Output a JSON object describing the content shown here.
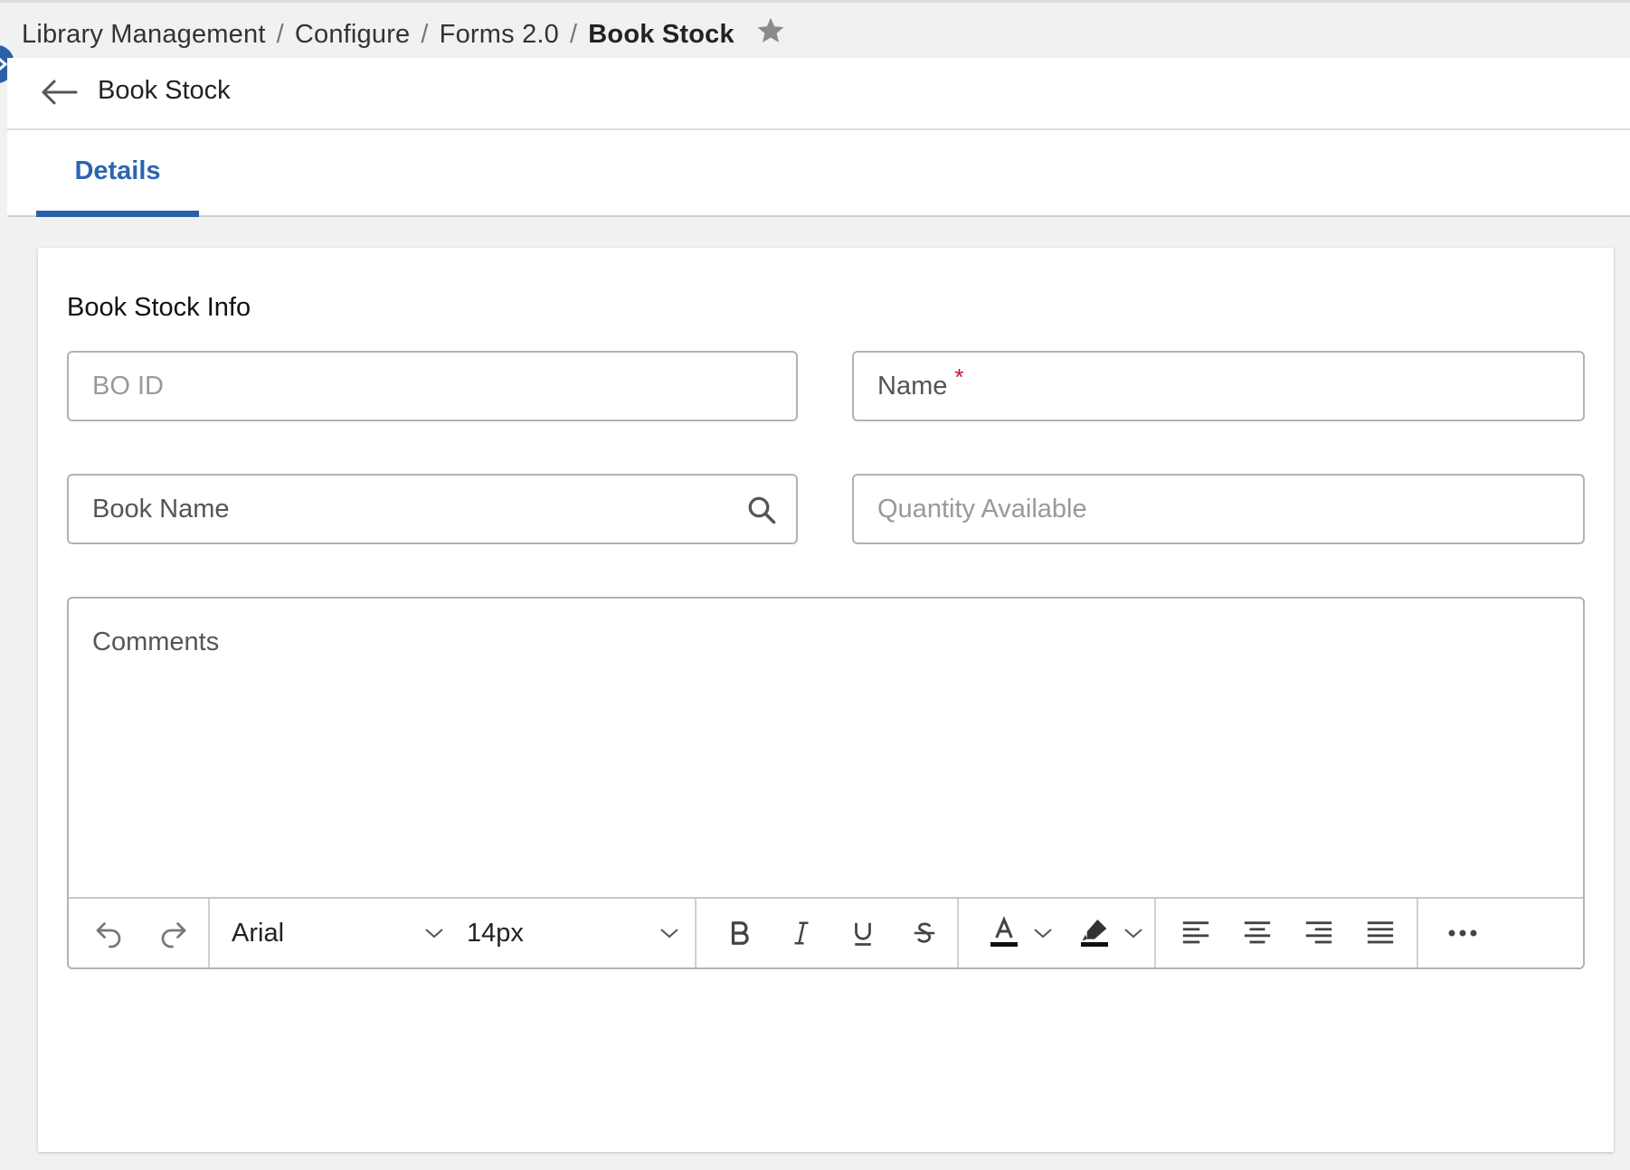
{
  "breadcrumb": {
    "items": [
      "Library Management",
      "Configure",
      "Forms 2.0"
    ],
    "current": "Book Stock",
    "separator": "/"
  },
  "header": {
    "title": "Book Stock"
  },
  "tabs": [
    {
      "label": "Details",
      "active": true
    }
  ],
  "section": {
    "title": "Book Stock Info"
  },
  "fields": {
    "bo_id": {
      "label": "BO ID"
    },
    "name": {
      "label": "Name",
      "required_marker": "*"
    },
    "book_name": {
      "label": "Book Name"
    },
    "quantity_available": {
      "label": "Quantity Available"
    },
    "comments": {
      "label": "Comments"
    }
  },
  "editor": {
    "font_family": "Arial",
    "font_size": "14px"
  },
  "icons": {
    "favorite": "star-icon",
    "back": "arrow-left-icon",
    "lookup": "search-icon"
  },
  "colors": {
    "accent": "#2c5fa8",
    "required": "#c8102e",
    "background": "#f0f1f1"
  }
}
